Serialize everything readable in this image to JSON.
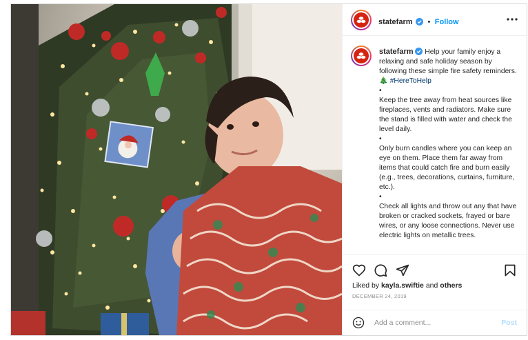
{
  "post": {
    "account": {
      "username": "statefarm",
      "follow_label": "Follow",
      "separator": "•",
      "brand_color": "#d62311",
      "accent_color": "#0095f6"
    },
    "caption": {
      "username": "statefarm",
      "intro": "Help your family enjoy a relaxing and safe holiday season by following these simple fire safety reminders. 🎄",
      "hashtag": "#HereToHelp",
      "bullet": "•",
      "tips": [
        "Keep the tree away from heat sources like fireplaces, vents and radiators. Make sure the stand is filled with water and check the level daily.",
        "Only burn candles where you can keep an eye on them. Place them far away from items that could catch fire and burn easily (e.g., trees, decorations, curtains, furniture, etc.).",
        "Check all lights and throw out any that have broken or cracked sockets, frayed or bare wires, or any loose connections. Never use electric lights on metallic trees."
      ]
    },
    "actions": {
      "icons": [
        "heart-icon",
        "comment-icon",
        "share-icon",
        "bookmark-icon"
      ]
    },
    "likes": {
      "prefix": "Liked by",
      "user": "kayla.swiftie",
      "connector": "and",
      "suffix": "others"
    },
    "date": "DECEMBER 24, 2019",
    "comment": {
      "placeholder": "Add a comment...",
      "post_label": "Post"
    }
  }
}
